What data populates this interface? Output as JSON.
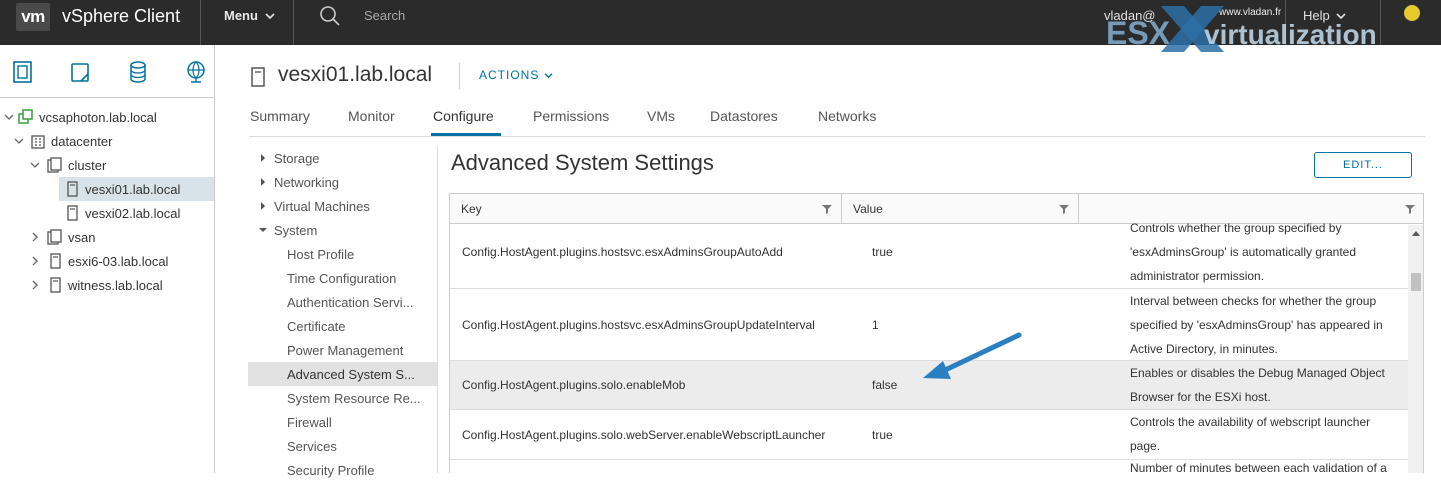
{
  "topbar": {
    "logo": "vm",
    "app_title": "vSphere Client",
    "menu_label": "Menu",
    "search_placeholder": "Search",
    "user": "vladan@",
    "help_label": "Help"
  },
  "watermark": {
    "url": "www.vladan.fr",
    "esx": "ESX",
    "virtualization": "virtualization"
  },
  "navigator": {
    "tabs": [
      "hosts-and-clusters",
      "vms-and-templates",
      "storage",
      "networking"
    ],
    "tree": [
      {
        "label": "vcsaphoton.lab.local",
        "icon": "vcenter-icon",
        "expanded": true,
        "level": 0
      },
      {
        "label": "datacenter",
        "icon": "datacenter-icon",
        "expanded": true,
        "level": 1
      },
      {
        "label": "cluster",
        "icon": "cluster-icon",
        "expanded": true,
        "level": 2
      },
      {
        "label": "vesxi01.lab.local",
        "icon": "host-icon",
        "level": 3,
        "selected": true
      },
      {
        "label": "vesxi02.lab.local",
        "icon": "host-icon",
        "level": 3
      },
      {
        "label": "vsan",
        "icon": "cluster-icon",
        "expanded": false,
        "level": 2
      },
      {
        "label": "esxi6-03.lab.local",
        "icon": "host-icon",
        "expanded": false,
        "level": 2
      },
      {
        "label": "witness.lab.local",
        "icon": "host-icon",
        "expanded": false,
        "level": 2
      }
    ]
  },
  "header": {
    "host_name": "vesxi01.lab.local",
    "actions_label": "ACTIONS"
  },
  "tabs": [
    {
      "label": "Summary"
    },
    {
      "label": "Monitor"
    },
    {
      "label": "Configure",
      "active": true
    },
    {
      "label": "Permissions"
    },
    {
      "label": "VMs"
    },
    {
      "label": "Datastores"
    },
    {
      "label": "Networks"
    }
  ],
  "config_menu": [
    {
      "label": "Storage",
      "type": "group",
      "expanded": false
    },
    {
      "label": "Networking",
      "type": "group",
      "expanded": false
    },
    {
      "label": "Virtual Machines",
      "type": "group",
      "expanded": false
    },
    {
      "label": "System",
      "type": "group",
      "expanded": true
    },
    {
      "label": "Host Profile",
      "type": "item"
    },
    {
      "label": "Time Configuration",
      "type": "item"
    },
    {
      "label": "Authentication Servi...",
      "type": "item"
    },
    {
      "label": "Certificate",
      "type": "item"
    },
    {
      "label": "Power Management",
      "type": "item"
    },
    {
      "label": "Advanced System S...",
      "type": "item",
      "selected": true
    },
    {
      "label": "System Resource Re...",
      "type": "item"
    },
    {
      "label": "Firewall",
      "type": "item"
    },
    {
      "label": "Services",
      "type": "item"
    },
    {
      "label": "Security Profile",
      "type": "item"
    }
  ],
  "content": {
    "title": "Advanced System Settings",
    "edit_label": "EDIT...",
    "columns": {
      "key": "Key",
      "value": "Value",
      "description": ""
    },
    "rows": [
      {
        "key": "Config.HostAgent.plugins.hostsvc.esxAdminsGroupAutoAdd",
        "value": "true",
        "description": [
          "Controls whether the group specified by",
          "'esxAdminsGroup' is automatically granted",
          "administrator permission."
        ]
      },
      {
        "key": "Config.HostAgent.plugins.hostsvc.esxAdminsGroupUpdateInterval",
        "value": "1",
        "description": [
          "Interval between checks for whether the group",
          "specified by 'esxAdminsGroup' has appeared in",
          "Active Directory, in minutes."
        ]
      },
      {
        "key": "Config.HostAgent.plugins.solo.enableMob",
        "value": "false",
        "description": [
          "Enables or disables the Debug Managed Object",
          "Browser for the ESXi host."
        ],
        "highlighted": true
      },
      {
        "key": "Config.HostAgent.plugins.solo.webServer.enableWebscriptLauncher",
        "value": "true",
        "description": [
          "Controls the availability of webscript launcher",
          "page."
        ]
      },
      {
        "key": "",
        "value": "",
        "description": [
          "Number of minutes between each validation of a"
        ]
      }
    ]
  },
  "colors": {
    "topbar": "#2b2b2b",
    "accent": "#0072a3",
    "selection": "#d8e3e9",
    "annotation_arrow": "#2a7fc1"
  }
}
